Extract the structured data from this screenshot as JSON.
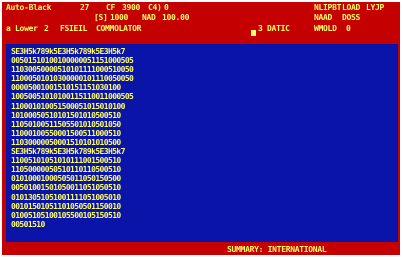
{
  "header": {
    "mode": "Auto-Black",
    "c1_label": "27",
    "cf_label": "CF",
    "cf_value": "3900",
    "c4_label": "C4)",
    "c4_value": "0",
    "row2_a": "[S]",
    "row2_b": "1000",
    "row2_c": "NAD",
    "row2_d": "100.00",
    "row3_a": "a Lower",
    "row3_b": "2",
    "row3_c": "FSIEIL",
    "row3_d": "COMMOLATOR",
    "row3_e": "3 DATIC",
    "right_1": "NLIPBT",
    "right_2": "LOAD",
    "right_3": "LYJP",
    "right_4": "NAAD",
    "right_5": "DOSS",
    "right_6": "WMOLD",
    "right_7": "0"
  },
  "dump": {
    "lines": [
      "SE3H5k789k5E3H5k789k5E3H5k7",
      "00501510100100000051151000505",
      "11030050000510101111000510050",
      "11000501010300000101110050050",
      "00005001001510151151030100",
      "10050051010100115110011000505",
      "110001010051500051015010100",
      "10100050510101501010500510",
      "11050100511505501010501050",
      "11000100550001500511000510",
      "11030000050001510101010500",
      "SE3H5k789k5E3H5k789k5E3H5k7",
      "11005101051010111001500510",
      "11050000050510110110500510",
      "01010001000505011050150500",
      "00501001501050011051050510",
      "01013051051001111051005010",
      "00101501051101050501150010",
      "01005105100105500105150510",
      "00501510"
    ]
  },
  "footer": {
    "text": "SUMMARY: INTERNATIONAL"
  },
  "colors": {
    "frame": "#c40000",
    "main_bg": "#0a14a8",
    "text": "#ffff66"
  }
}
